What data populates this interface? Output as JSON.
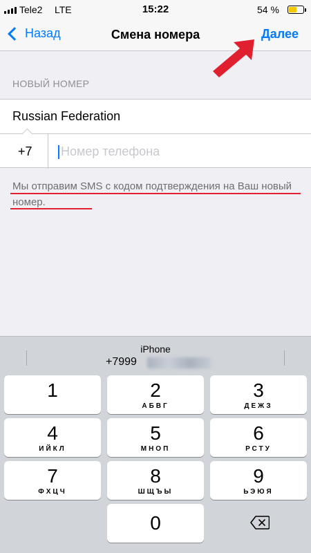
{
  "status_bar": {
    "carrier": "Tele2",
    "network": "LTE",
    "time": "15:22",
    "battery_percent": "54 %",
    "battery_level": 0.54
  },
  "nav": {
    "back_label": "Назад",
    "title": "Смена номера",
    "next_label": "Далее"
  },
  "form": {
    "section_header": "НОВЫЙ НОМЕР",
    "country": "Russian Federation",
    "country_code": "+7",
    "phone_placeholder": "Номер телефона",
    "phone_value": ""
  },
  "hint": "Мы отправим SMS с кодом подтверждения на Ваш новый номер.",
  "keyboard": {
    "suggestion_title": "iPhone",
    "suggestion_number": "+7999",
    "keys": [
      {
        "digit": "1",
        "letters": ""
      },
      {
        "digit": "2",
        "letters": "АБВГ"
      },
      {
        "digit": "3",
        "letters": "ДЕЖЗ"
      },
      {
        "digit": "4",
        "letters": "ИЙКЛ"
      },
      {
        "digit": "5",
        "letters": "МНОП"
      },
      {
        "digit": "6",
        "letters": "РСТУ"
      },
      {
        "digit": "7",
        "letters": "ФХЦЧ"
      },
      {
        "digit": "8",
        "letters": "ШЩЪЫ"
      },
      {
        "digit": "9",
        "letters": "ЬЭЮЯ"
      },
      {
        "digit": "0",
        "letters": ""
      }
    ]
  },
  "colors": {
    "accent": "#007aff",
    "annotation": "#e0202e",
    "battery": "#f6c800"
  }
}
